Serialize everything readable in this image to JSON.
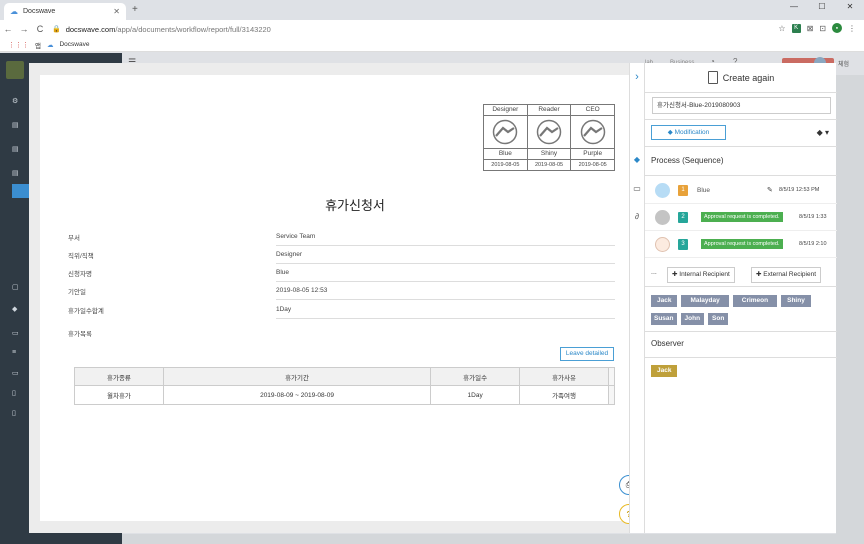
{
  "browser": {
    "tab_title": "Docswave",
    "url_host": "docswave.com",
    "url_path": "/app/a/documents/workflow/report/full/3143220",
    "bookmark_apps": "앱",
    "bookmark_docswave": "Docswave"
  },
  "background": {
    "header_text_1": "lab",
    "header_text_2": "Business",
    "user_name": "체험"
  },
  "document": {
    "title": "휴가신청서",
    "approval": [
      {
        "role": "Designer",
        "name": "Blue",
        "date": "2019-08-05"
      },
      {
        "role": "Reader",
        "name": "Shiny",
        "date": "2019-08-05"
      },
      {
        "role": "CEO",
        "name": "Purple",
        "date": "2019-08-05"
      }
    ],
    "fields": [
      {
        "label": "부서",
        "value": "Service Team"
      },
      {
        "label": "직위/직책",
        "value": "Designer"
      },
      {
        "label": "신청자명",
        "value": "Blue"
      },
      {
        "label": "기안일",
        "value": "2019-08-05 12:53"
      },
      {
        "label": "휴가일수합계",
        "value": "1Day"
      }
    ],
    "list_label": "휴가목록",
    "leave_detailed": "Leave detailed",
    "table": {
      "headers": [
        "휴가종류",
        "휴가기간",
        "휴가일수",
        "휴가사유"
      ],
      "rows": [
        [
          "월차휴가",
          "2019-08-09 ~ 2019-08-09",
          "1Day",
          "가족여행"
        ]
      ]
    }
  },
  "panel": {
    "title": "Create again",
    "doc_number": "휴가신청서-Blue-2019080903",
    "modification": "Modification",
    "process_title": "Process (Sequence)",
    "steps": [
      {
        "num": "1",
        "who": "Blue",
        "time": "8/5/19 12:53 PM",
        "color": "#e8a23a"
      },
      {
        "num": "2",
        "status": "Approval request is completed.",
        "time": "8/5/19 1:33",
        "color": "#26a69a"
      },
      {
        "num": "3",
        "status": "Approval request is completed.",
        "time": "8/5/19 2:10",
        "color": "#26a69a"
      }
    ],
    "more": "...",
    "internal_recipient": "Internal Recipient",
    "external_recipient": "External Recipient",
    "recipients": [
      "Jack",
      "Malayday",
      "Crimeon",
      "Shiny",
      "Susan",
      "John",
      "Son"
    ],
    "observer_title": "Observer",
    "observers": [
      "Jack"
    ]
  }
}
